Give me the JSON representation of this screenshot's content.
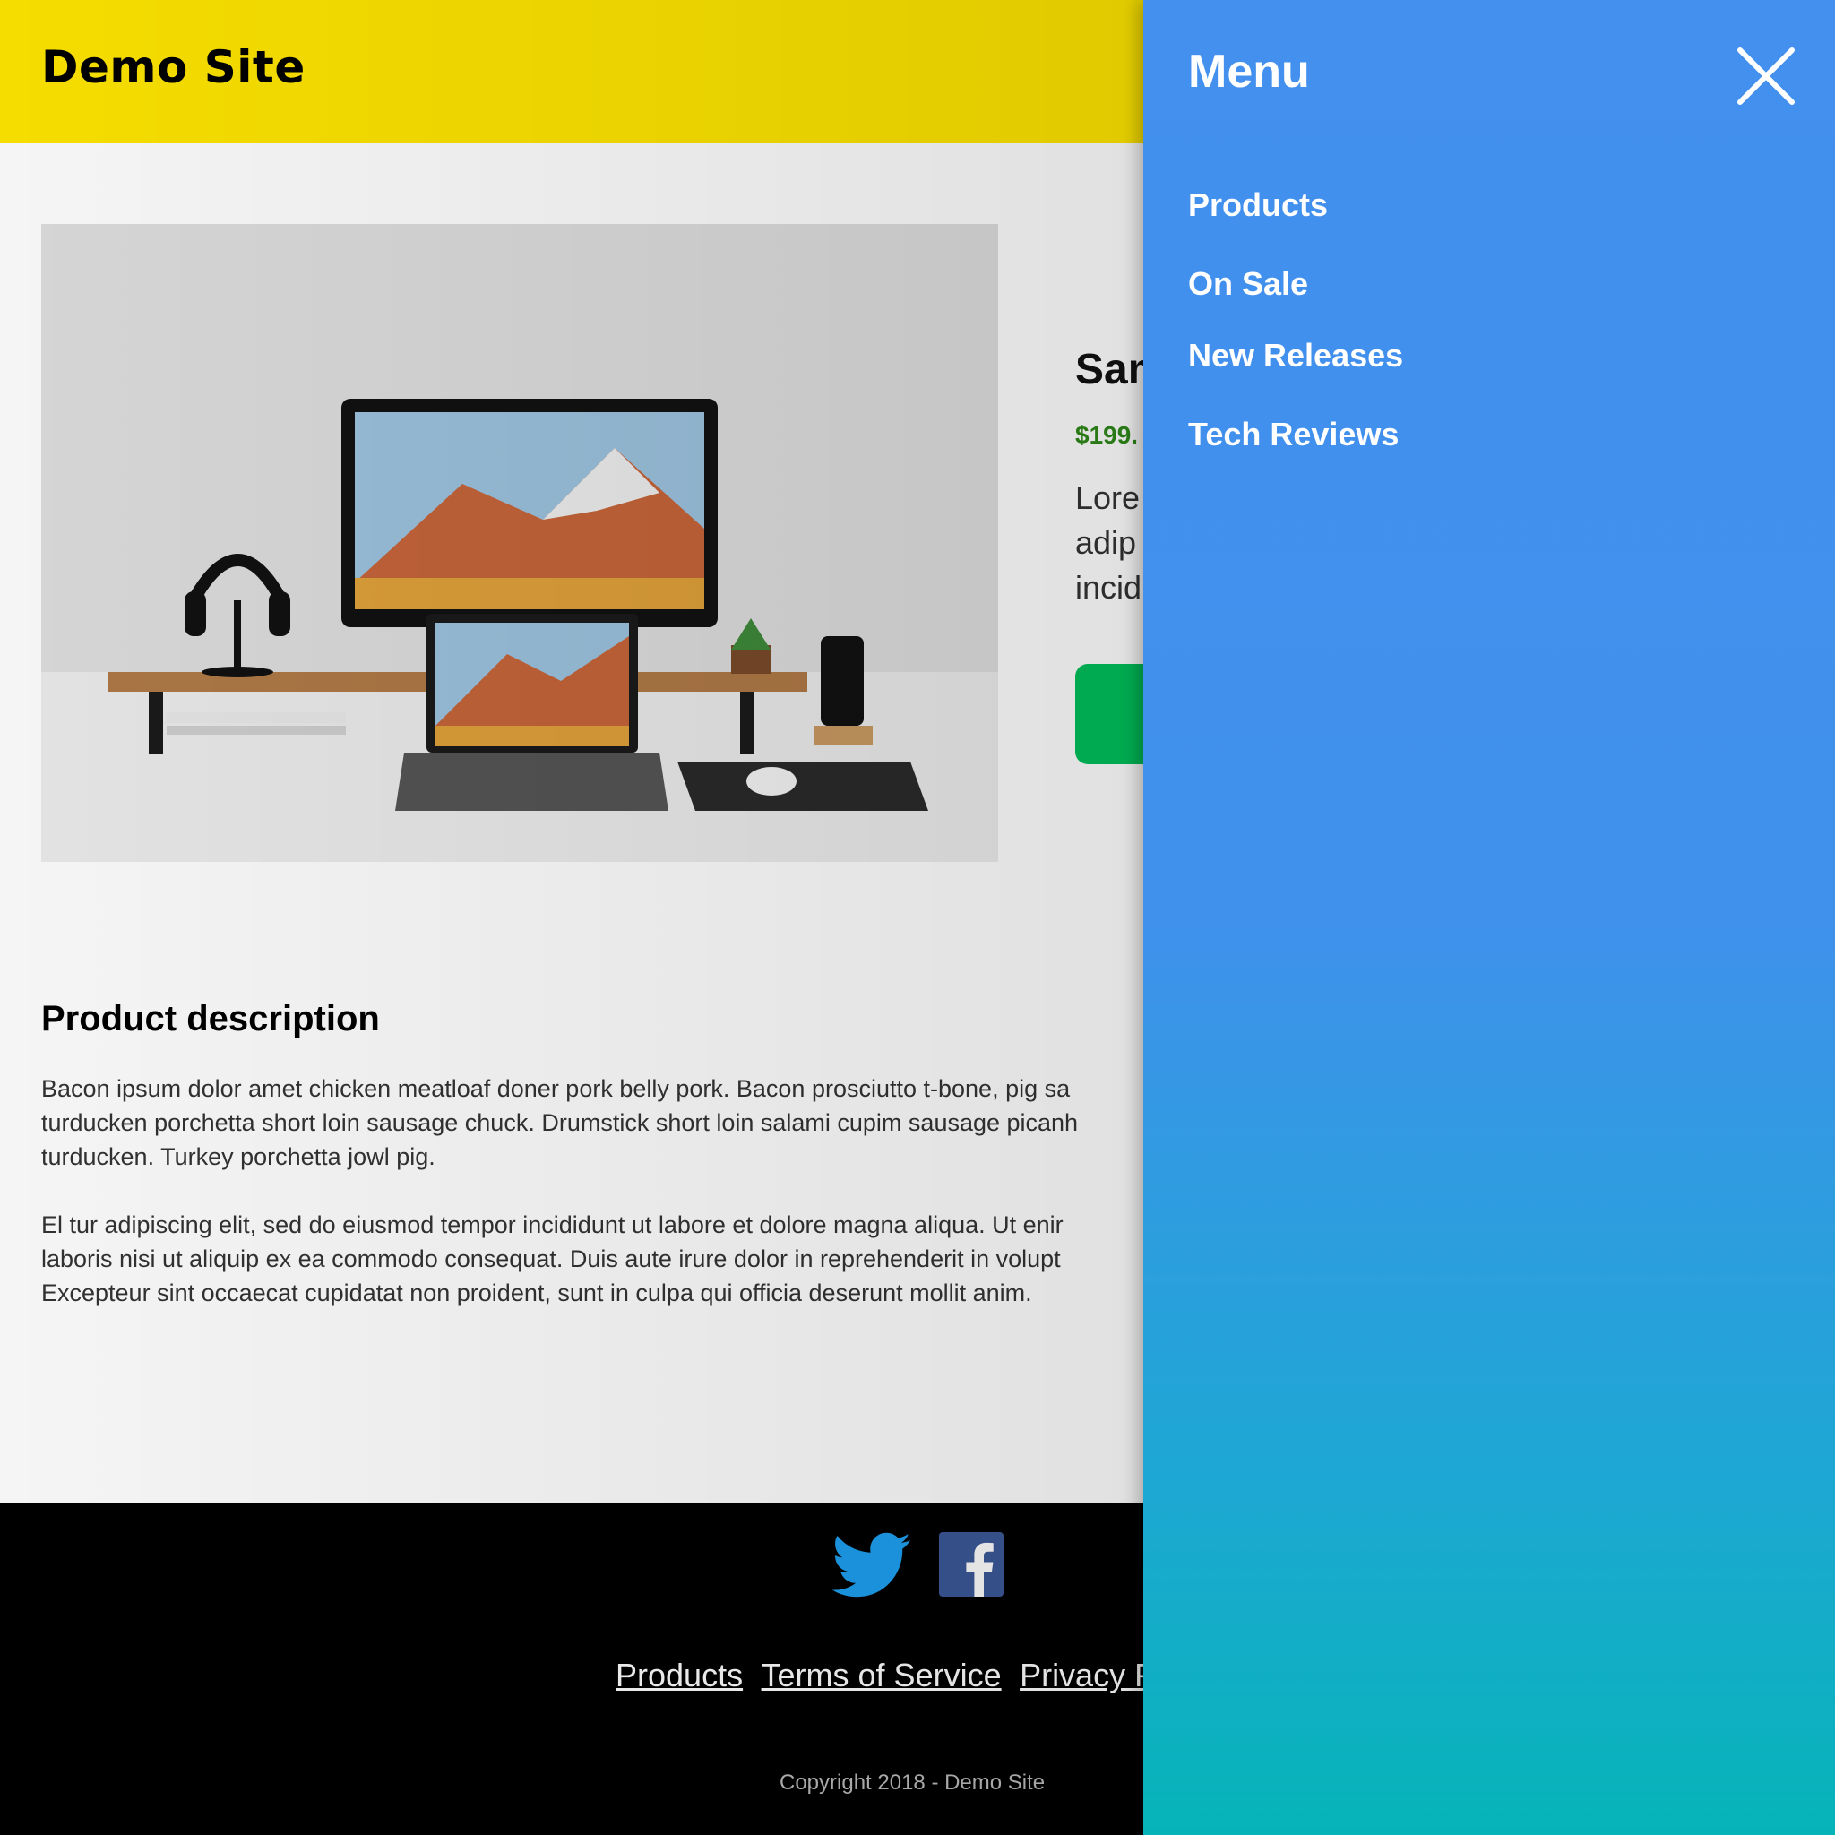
{
  "header": {
    "site_title": "Demo Site"
  },
  "product": {
    "title": "Sam",
    "price": "$199.",
    "summary_lines": [
      "Lore",
      "adip",
      "incid"
    ],
    "buy_button_label": ""
  },
  "description": {
    "heading": "Product description",
    "paragraph1_lines": [
      "Bacon ipsum dolor amet chicken meatloaf doner pork belly pork. Bacon prosciutto t-bone, pig sa",
      "turducken porchetta short loin sausage chuck. Drumstick short loin salami cupim sausage picanh",
      "turducken. Turkey porchetta jowl pig."
    ],
    "paragraph2_lines": [
      "El tur adipiscing elit, sed do eiusmod tempor incididunt ut labore et dolore magna aliqua. Ut enir",
      "laboris nisi ut aliquip ex ea commodo consequat. Duis aute irure dolor in reprehenderit in volupt",
      "Excepteur sint occaecat cupidatat non proident, sunt in culpa qui officia deserunt mollit anim."
    ]
  },
  "footer": {
    "social": [
      {
        "name": "twitter",
        "icon": "twitter-icon"
      },
      {
        "name": "facebook",
        "icon": "facebook-icon"
      }
    ],
    "links": [
      "Products",
      "Terms of Service",
      "Privacy P"
    ],
    "copyright": "Copyright 2018 - Demo Site"
  },
  "menu": {
    "title": "Menu",
    "close_icon": "close-icon",
    "items": [
      "Products",
      "On Sale",
      "New Releases",
      "Tech Reviews"
    ]
  },
  "colors": {
    "header_bg": "#ffe600",
    "menu_top": "#4390ee",
    "menu_bottom": "#06b4b8",
    "price_green": "#2e8a19",
    "button_green": "#00c05a",
    "twitter_blue": "#1da1f2",
    "facebook_blue": "#3b5998"
  }
}
